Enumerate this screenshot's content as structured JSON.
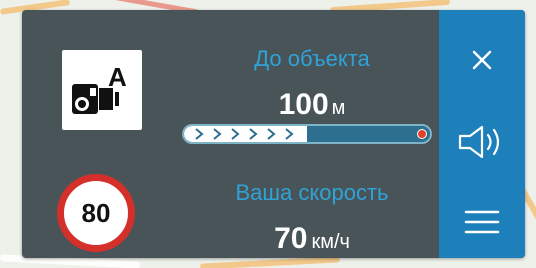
{
  "camera": {
    "icon": "speed-camera-icon",
    "lane_letter": "A"
  },
  "speed_limit": {
    "value": "80",
    "colors": {
      "ring": "#d3302c",
      "fill": "#ffffff"
    }
  },
  "distance": {
    "label": "До объекта",
    "value": "100",
    "unit": "м",
    "progress_fraction": 0.5
  },
  "current_speed": {
    "label": "Ваша скорость",
    "value": "70",
    "unit": "км/ч"
  },
  "controls": {
    "close_icon": "close-icon",
    "sound_icon": "speaker-icon",
    "menu_icon": "hamburger-menu-icon"
  },
  "colors": {
    "panel": "#485457",
    "accent_text": "#2fa3d8",
    "side_bar": "#1d80bb",
    "progress_track": "#2d6f8f",
    "progress_end": "#e2412e"
  }
}
